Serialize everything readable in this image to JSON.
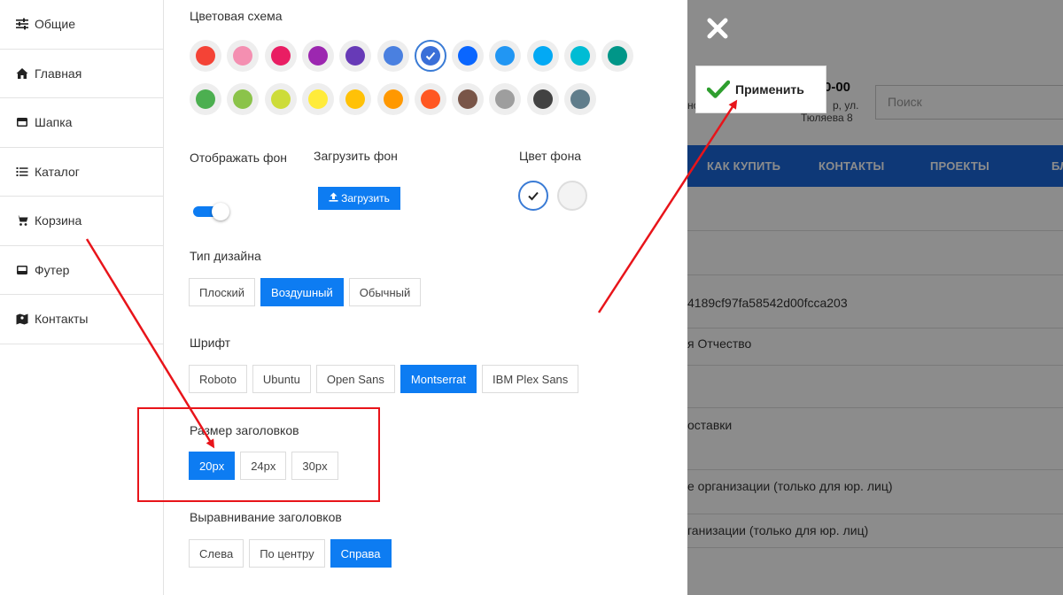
{
  "sidebar": {
    "items": [
      {
        "label": "Общие",
        "icon": "sliders-icon"
      },
      {
        "label": "Главная",
        "icon": "home-icon"
      },
      {
        "label": "Шапка",
        "icon": "header-icon"
      },
      {
        "label": "Каталог",
        "icon": "list-icon"
      },
      {
        "label": "Корзина",
        "icon": "cart-icon"
      },
      {
        "label": "Футер",
        "icon": "footer-icon"
      },
      {
        "label": "Контакты",
        "icon": "map-icon"
      }
    ]
  },
  "panel": {
    "color_scheme_label": "Цветовая схема",
    "color_row1": [
      "#f44336",
      "#f48fb1",
      "#e91e63",
      "#9c27b0",
      "#673ab7",
      "#4a80e0",
      "#3a6fd8",
      "#0a66ff",
      "#2196f3",
      "#03a9f4",
      "#00bcd4",
      "#009688"
    ],
    "color_row2": [
      "#4caf50",
      "#8bc34a",
      "#cddc39",
      "#ffeb3b",
      "#ffc107",
      "#ff9800",
      "#ff5722",
      "#795548",
      "#9e9e9e",
      "#424242",
      "#607d8b"
    ],
    "selected_color_index": 6,
    "show_bg_label": "Отображать фон",
    "upload_bg_label": "Загрузить фон",
    "upload_button": "Загрузить",
    "bg_color_label": "Цвет фона",
    "design_type_label": "Тип дизайна",
    "design_types": [
      "Плоский",
      "Воздушный",
      "Обычный"
    ],
    "design_active": 1,
    "font_label": "Шрифт",
    "fonts": [
      "Roboto",
      "Ubuntu",
      "Open Sans",
      "Montserrat",
      "IBM Plex Sans"
    ],
    "font_active": 3,
    "heading_size_label": "Размер заголовков",
    "heading_sizes": [
      "20px",
      "24px",
      "30px"
    ],
    "heading_size_active": 0,
    "heading_align_label": "Выравнивание заголовков",
    "heading_aligns": [
      "Слева",
      "По центру",
      "Справа"
    ],
    "heading_align_active": 2
  },
  "apply_button": "Применить",
  "background_site": {
    "phone": "0-00",
    "address_0": "но",
    "address_1": "р, ул.",
    "address_2": "Тюляева 8",
    "search_placeholder": "Поиск",
    "nav": [
      "КАК КУПИТЬ",
      "КОНТАКТЫ",
      "ПРОЕКТЫ",
      "БЛ"
    ],
    "rows": [
      "4189cf97fa58542d00fcca203",
      "я Отчество",
      "оставки",
      "е организации (только для юр. лиц)",
      "ганизации (только для юр. лиц)"
    ]
  },
  "colors": {
    "accent": "#0d7cf2",
    "annotation_red": "#e8141a",
    "nav_blue": "#1a66d9",
    "apply_check_green": "#2e9e2e"
  }
}
